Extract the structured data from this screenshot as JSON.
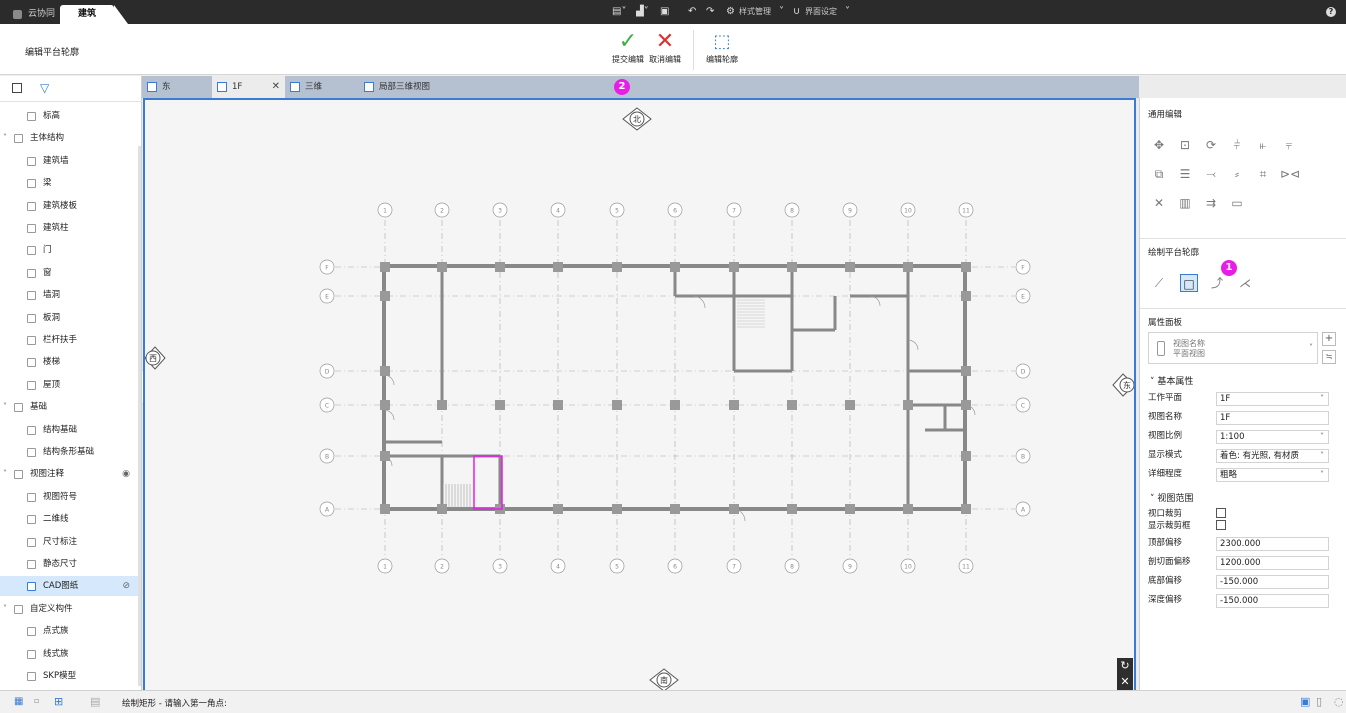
{
  "app_tabs": {
    "cloud": "云协同",
    "build": "建筑"
  },
  "toolbar": {
    "style_mgmt": "样式管理",
    "ui_settings": "界面设定"
  },
  "ribbon": {
    "title": "编辑平台轮廓",
    "submit_label": "提交编辑",
    "cancel_label": "取消编辑",
    "edit_outline_label": "编辑轮廓"
  },
  "tree": {
    "items": [
      {
        "label": "标高",
        "level": 1
      },
      {
        "label": "主体结构",
        "level": 0,
        "expanded": true
      },
      {
        "label": "建筑墙",
        "level": 1
      },
      {
        "label": "梁",
        "level": 1
      },
      {
        "label": "建筑楼板",
        "level": 1
      },
      {
        "label": "建筑柱",
        "level": 1
      },
      {
        "label": "门",
        "level": 1
      },
      {
        "label": "窗",
        "level": 1
      },
      {
        "label": "墙洞",
        "level": 1
      },
      {
        "label": "板洞",
        "level": 1
      },
      {
        "label": "栏杆扶手",
        "level": 1
      },
      {
        "label": "楼梯",
        "level": 1
      },
      {
        "label": "屋顶",
        "level": 1
      },
      {
        "label": "基础",
        "level": 0,
        "expanded": true
      },
      {
        "label": "结构基础",
        "level": 1
      },
      {
        "label": "结构条形基础",
        "level": 1
      },
      {
        "label": "视图注释",
        "level": 0,
        "expanded": true,
        "eye": "visible"
      },
      {
        "label": "视图符号",
        "level": 1
      },
      {
        "label": "二维线",
        "level": 1
      },
      {
        "label": "尺寸标注",
        "level": 1
      },
      {
        "label": "静态尺寸",
        "level": 1
      },
      {
        "label": "CAD图纸",
        "level": 1,
        "selected": true,
        "eye": "hidden"
      },
      {
        "label": "自定义构件",
        "level": 0,
        "expanded": true
      },
      {
        "label": "点式族",
        "level": 1
      },
      {
        "label": "线式族",
        "level": 1
      },
      {
        "label": "SKP模型",
        "level": 1
      }
    ]
  },
  "view_tabs": [
    {
      "label": "东"
    },
    {
      "label": "1F",
      "active": true
    },
    {
      "label": "三维"
    },
    {
      "label": "局部三维视图"
    }
  ],
  "compass": {
    "north": "北",
    "south": "南",
    "east": "东",
    "west": "西"
  },
  "grid": {
    "columns": [
      "1",
      "2",
      "3",
      "4",
      "5",
      "6",
      "7",
      "8",
      "9",
      "10",
      "11"
    ],
    "rows": [
      "F",
      "E",
      "D",
      "C",
      "B",
      "A"
    ]
  },
  "badges": {
    "one": "1",
    "two": "2"
  },
  "right": {
    "general_edit": "通用编辑",
    "draw_outline": "绘制平台轮廓",
    "prop_panel": "属性面板",
    "view_type_name": "视图名称",
    "view_type_sub": "平面视图",
    "basic_props": "基本属性",
    "props": [
      {
        "label": "工作平面",
        "value": "1F",
        "dropdown": true
      },
      {
        "label": "视图名称",
        "value": "1F",
        "dropdown": false
      },
      {
        "label": "视图比例",
        "value": "1:100",
        "dropdown": true
      },
      {
        "label": "显示模式",
        "value": "着色: 有光照, 有材质",
        "dropdown": true
      },
      {
        "label": "详细程度",
        "value": "粗略",
        "dropdown": true
      }
    ],
    "view_range": "视图范围",
    "range_checks": [
      {
        "label": "视口裁剪"
      },
      {
        "label": "显示裁剪框"
      }
    ],
    "range_props": [
      {
        "label": "顶部偏移",
        "value": "2300.000"
      },
      {
        "label": "剖切面偏移",
        "value": "1200.000"
      },
      {
        "label": "底部偏移",
        "value": "-150.000"
      },
      {
        "label": "深度偏移",
        "value": "-150.000"
      }
    ]
  },
  "status": {
    "prompt": "绘制矩形 - 请输入第一角点:"
  },
  "colors": {
    "accent": "#3a7bd5",
    "badge": "#e61ee6",
    "highlight": "#e61ee6"
  }
}
